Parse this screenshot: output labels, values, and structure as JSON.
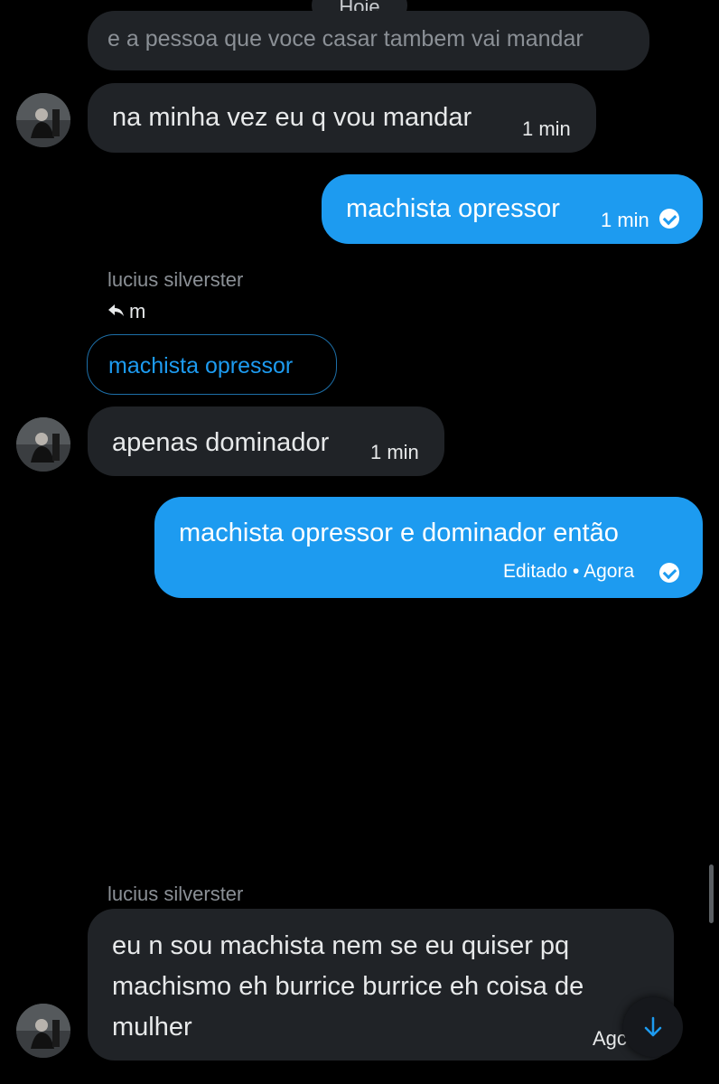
{
  "day_divider": "Hoje",
  "messages": [
    {
      "text": "e a pessoa que voce casar tambem vai mandar"
    },
    {
      "text": "na minha vez eu q vou mandar",
      "time": "1 min"
    },
    {
      "text": "machista opressor",
      "time": "1 min"
    },
    {
      "sender": "lucius silverster",
      "reply_to": "m",
      "quoted": "machista opressor"
    },
    {
      "text": "apenas dominador",
      "time": "1 min"
    },
    {
      "text": "machista opressor e dominador então",
      "edited": "Editado • Agora"
    },
    {
      "sender": "lucius silverster",
      "text_lines": [
        "eu n sou machista nem se eu quiser pq",
        "machismo eh burrice burrice eh coisa de",
        "mulher"
      ],
      "time_partial": "Agc"
    }
  ],
  "icons": {
    "reply": "reply-arrow-icon",
    "read_receipt": "check-circle-icon",
    "scroll_down": "arrow-down-icon"
  },
  "colors": {
    "background": "#000000",
    "incoming_bubble": "#202327",
    "outgoing_bubble": "#1d9bf0",
    "accent": "#1d9bf0"
  }
}
